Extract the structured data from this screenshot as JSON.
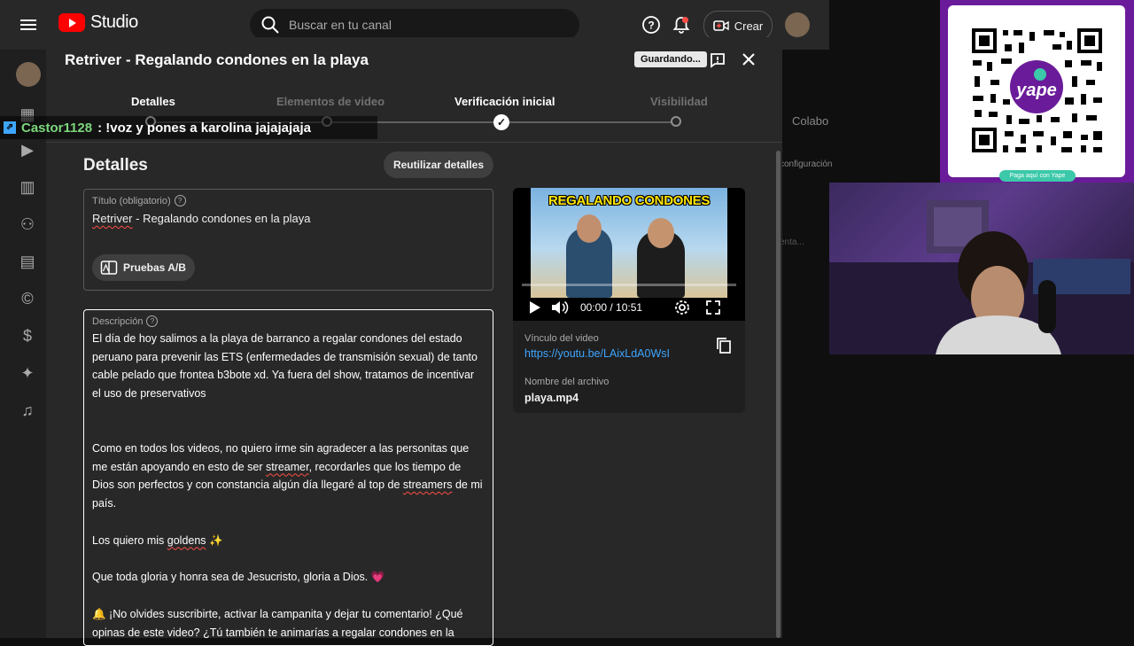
{
  "app": {
    "name": "Studio",
    "search_placeholder": "Buscar en tu canal",
    "create_label": "Crear"
  },
  "background_text": {
    "collab": "Colabo",
    "config": "configuración",
    "fragment": "enta..."
  },
  "modal": {
    "title": "Retriver - Regalando condones en la playa",
    "saving_label": "Guardando...",
    "steps": [
      {
        "label": "Detalles",
        "state": "current"
      },
      {
        "label": "Elementos de video",
        "state": "pending"
      },
      {
        "label": "Verificación inicial",
        "state": "done"
      },
      {
        "label": "Visibilidad",
        "state": "pending"
      }
    ],
    "section_title": "Detalles",
    "reuse_label": "Reutilizar detalles",
    "title_field": {
      "label": "Título (obligatorio)",
      "value_word1": "Retriver",
      "value_rest": " - Regalando condones en la playa"
    },
    "ab_label": "Pruebas A/B",
    "description": {
      "label": "Descripción",
      "p1": "El día de hoy salimos a la playa de barranco a regalar condones del estado peruano para prevenir las ETS (enfermedades de transmisión sexual) de tanto cable pelado que frontea b3bote xd. Ya fuera del show, tratamos de incentivar el uso de preservativos",
      "p2_a": "Como en todos los videos, no quiero irme sin agradecer a las personitas que me están apoyando en esto de ser ",
      "p2_streamer": "streamer",
      "p2_b": ", recordarles que los tiempo de Dios son perfectos y con constancia algún día llegaré al top de ",
      "p2_streamers": "streamers",
      "p2_c": " de mi país.",
      "p3_a": "Los quiero mis ",
      "p3_goldens": "goldens",
      "p3_emoji": " ✨",
      "p4": "Que toda gloria y honra sea de Jesucristo, gloria a Dios. 💗",
      "p5": "🔔 ¡No olvides suscribirte, activar la campanita y dejar tu comentario! ¿Qué opinas de este video? ¿Tú también te animarías a regalar condones en la"
    },
    "preview": {
      "thumb_title": "REGALANDO CONDONES",
      "time": "00:00 / 10:51",
      "link_label": "Vínculo del video",
      "link": "https://youtu.be/LAixLdA0WsI",
      "file_label": "Nombre del archivo",
      "file_name": "playa.mp4"
    }
  },
  "chat": {
    "user": "Castor1128",
    "message": ": !voz y pones a karolina jajajajaja"
  },
  "yape": {
    "label": "Paga aquí con Yape",
    "logo": "yape"
  },
  "colors": {
    "accent_link": "#3ea6ff",
    "yape_purple": "#6a1b9a",
    "yape_green": "#3bc9a9",
    "chat_user": "#7cd67c"
  }
}
